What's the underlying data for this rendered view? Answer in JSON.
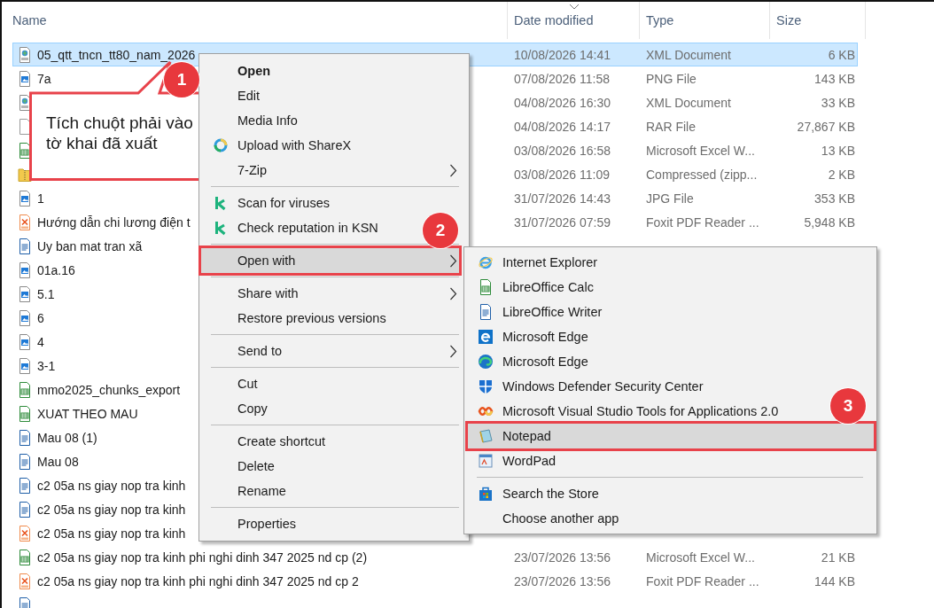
{
  "columns": [
    {
      "label": "Name",
      "sorted": false
    },
    {
      "label": "Date modified",
      "sorted": true
    },
    {
      "label": "Type",
      "sorted": false
    },
    {
      "label": "Size",
      "sorted": false
    }
  ],
  "files": [
    {
      "kind": "xml",
      "name": "05_qtt_tncn_tt80_nam_2026",
      "date": "10/08/2026 14:41",
      "type": "XML Document",
      "size": "6 KB",
      "selected": true
    },
    {
      "kind": "image",
      "name": "7a",
      "date": "07/08/2026 11:58",
      "type": "PNG File",
      "size": "143 KB",
      "selected": false
    },
    {
      "kind": "xml",
      "date": "04/08/2026 16:30",
      "type": "XML Document",
      "size": "33 KB",
      "selected": false
    },
    {
      "kind": "blank",
      "date": "04/08/2026 14:17",
      "type": "RAR File",
      "size": "27,867 KB",
      "selected": false
    },
    {
      "kind": "calc",
      "date": "03/08/2026 16:58",
      "type": "Microsoft Excel W...",
      "size": "13 KB",
      "selected": false
    },
    {
      "kind": "zip",
      "date": "03/08/2026 11:09",
      "type": "Compressed (zipp...",
      "size": "2 KB",
      "selected": false
    },
    {
      "kind": "image",
      "name": "1",
      "date": "31/07/2026 14:43",
      "type": "JPG File",
      "size": "353 KB",
      "selected": false
    },
    {
      "kind": "pdf",
      "name": "Hướng dẫn chi lương điện t",
      "date": "31/07/2026 07:59",
      "type": "Foxit PDF Reader ...",
      "size": "5,948 KB",
      "selected": false
    },
    {
      "kind": "writer",
      "name": "Uy ban mat tran xã",
      "selected": false
    },
    {
      "kind": "image",
      "name": "01a.16",
      "selected": false
    },
    {
      "kind": "image",
      "name": "5.1",
      "selected": false
    },
    {
      "kind": "image",
      "name": "6",
      "selected": false
    },
    {
      "kind": "image",
      "name": "4",
      "selected": false
    },
    {
      "kind": "image",
      "name": "3-1",
      "selected": false
    },
    {
      "kind": "calc",
      "name": "mmo2025_chunks_export",
      "selected": false
    },
    {
      "kind": "calc",
      "name": "XUAT THEO MAU",
      "selected": false
    },
    {
      "kind": "writer",
      "name": "Mau 08 (1)",
      "selected": false
    },
    {
      "kind": "writer",
      "name": "Mau 08",
      "selected": false
    },
    {
      "kind": "writer",
      "name": "c2 05a ns giay nop tra kinh",
      "selected": false
    },
    {
      "kind": "writer",
      "name": "c2 05a ns giay nop tra kinh",
      "selected": false
    },
    {
      "kind": "pdf",
      "name": "c2 05a ns giay nop tra kinh",
      "selected": false
    },
    {
      "kind": "calc",
      "name": "c2 05a ns giay nop tra kinh phi nghi dinh 347 2025 nd cp (2)",
      "date": "23/07/2026 13:56",
      "type": "Microsoft Excel W...",
      "size": "21 KB",
      "selected": false
    },
    {
      "kind": "pdf",
      "name": "c2 05a ns giay nop tra kinh phi nghi dinh 347 2025 nd cp 2",
      "date": "23/07/2026 13:56",
      "type": "Foxit PDF Reader ...",
      "size": "144 KB",
      "selected": false
    },
    {
      "kind": "writer",
      "selected": false
    }
  ],
  "callout": {
    "text": "Tích chuột phải vào tờ khai đã xuất",
    "step": "1"
  },
  "context_menu": {
    "items": [
      {
        "kind": "plain",
        "label": "Open",
        "default": true,
        "has_submenu": false,
        "selected": false
      },
      {
        "kind": "plain",
        "label": "Edit",
        "default": false,
        "has_submenu": false,
        "selected": false
      },
      {
        "kind": "plain",
        "label": "Media Info",
        "default": false,
        "has_submenu": false,
        "selected": false
      },
      {
        "kind": "sharex",
        "label": "Upload with ShareX",
        "default": false,
        "has_submenu": false,
        "selected": false
      },
      {
        "kind": "plain",
        "label": "7-Zip",
        "default": false,
        "has_submenu": true,
        "selected": false
      },
      {
        "kind": "separator"
      },
      {
        "kind": "kaspersky",
        "label": "Scan for viruses",
        "default": false,
        "has_submenu": false,
        "selected": false
      },
      {
        "kind": "kaspersky",
        "label": "Check reputation in KSN",
        "default": false,
        "has_submenu": false,
        "selected": false
      },
      {
        "kind": "separator"
      },
      {
        "kind": "plain",
        "label": "Open with",
        "default": false,
        "has_submenu": true,
        "selected": true,
        "step": "2"
      },
      {
        "kind": "separator"
      },
      {
        "kind": "plain",
        "label": "Share with",
        "default": false,
        "has_submenu": true,
        "selected": false
      },
      {
        "kind": "plain",
        "label": "Restore previous versions",
        "default": false,
        "has_submenu": false,
        "selected": false
      },
      {
        "kind": "separator"
      },
      {
        "kind": "plain",
        "label": "Send to",
        "default": false,
        "has_submenu": true,
        "selected": false
      },
      {
        "kind": "separator"
      },
      {
        "kind": "plain",
        "label": "Cut",
        "default": false,
        "has_submenu": false,
        "selected": false
      },
      {
        "kind": "plain",
        "label": "Copy",
        "default": false,
        "has_submenu": false,
        "selected": false
      },
      {
        "kind": "separator"
      },
      {
        "kind": "plain",
        "label": "Create shortcut",
        "default": false,
        "has_submenu": false,
        "selected": false
      },
      {
        "kind": "plain",
        "label": "Delete",
        "default": false,
        "has_submenu": false,
        "selected": false
      },
      {
        "kind": "plain",
        "label": "Rename",
        "default": false,
        "has_submenu": false,
        "selected": false
      },
      {
        "kind": "separator"
      },
      {
        "kind": "plain",
        "label": "Properties",
        "default": false,
        "has_submenu": false,
        "selected": false
      }
    ]
  },
  "open_with_menu": {
    "items": [
      {
        "kind": "ie",
        "label": "Internet Explorer",
        "selected": false
      },
      {
        "kind": "calc",
        "label": "LibreOffice Calc",
        "selected": false
      },
      {
        "kind": "writer",
        "label": "LibreOffice Writer",
        "selected": false
      },
      {
        "kind": "edge-legacy",
        "label": "Microsoft Edge",
        "selected": false
      },
      {
        "kind": "edge",
        "label": "Microsoft Edge",
        "selected": false
      },
      {
        "kind": "defender",
        "label": "Windows Defender Security Center",
        "selected": false
      },
      {
        "kind": "vsta",
        "label": "Microsoft Visual Studio Tools for Applications 2.0",
        "selected": false
      },
      {
        "kind": "notepad",
        "label": "Notepad",
        "selected": true,
        "step": "3"
      },
      {
        "kind": "wordpad",
        "label": "WordPad",
        "selected": false
      },
      {
        "kind": "separator"
      },
      {
        "kind": "store",
        "label": "Search the Store",
        "selected": false
      },
      {
        "kind": "plain",
        "label": "Choose another app",
        "selected": false
      }
    ]
  }
}
